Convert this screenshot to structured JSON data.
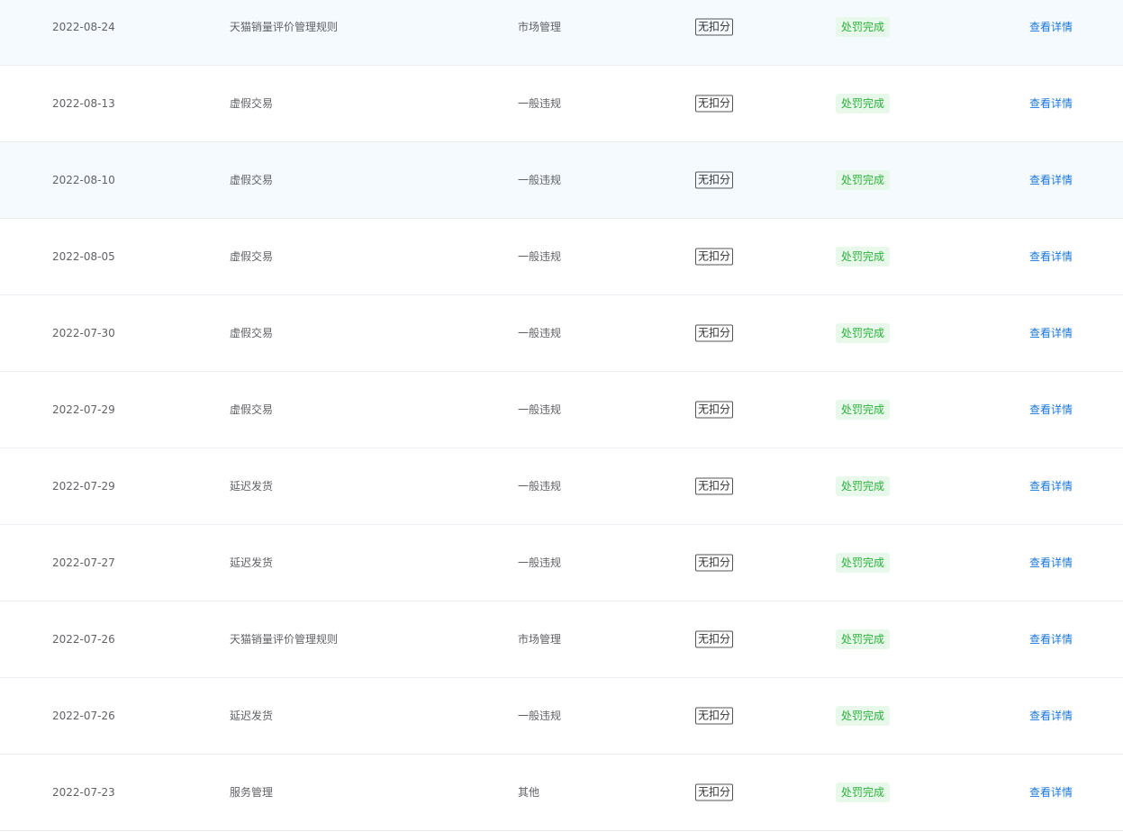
{
  "table": {
    "rows": [
      {
        "date": "2022-08-24",
        "reason": "天猫销量评价管理规则",
        "type": "市场管理",
        "points": "无扣分",
        "status": "处罚完成",
        "action": "查看详情"
      },
      {
        "date": "2022-08-13",
        "reason": "虚假交易",
        "type": "一般违规",
        "points": "无扣分",
        "status": "处罚完成",
        "action": "查看详情"
      },
      {
        "date": "2022-08-10",
        "reason": "虚假交易",
        "type": "一般违规",
        "points": "无扣分",
        "status": "处罚完成",
        "action": "查看详情"
      },
      {
        "date": "2022-08-05",
        "reason": "虚假交易",
        "type": "一般违规",
        "points": "无扣分",
        "status": "处罚完成",
        "action": "查看详情"
      },
      {
        "date": "2022-07-30",
        "reason": "虚假交易",
        "type": "一般违规",
        "points": "无扣分",
        "status": "处罚完成",
        "action": "查看详情"
      },
      {
        "date": "2022-07-29",
        "reason": "虚假交易",
        "type": "一般违规",
        "points": "无扣分",
        "status": "处罚完成",
        "action": "查看详情"
      },
      {
        "date": "2022-07-29",
        "reason": "延迟发货",
        "type": "一般违规",
        "points": "无扣分",
        "status": "处罚完成",
        "action": "查看详情"
      },
      {
        "date": "2022-07-27",
        "reason": "延迟发货",
        "type": "一般违规",
        "points": "无扣分",
        "status": "处罚完成",
        "action": "查看详情"
      },
      {
        "date": "2022-07-26",
        "reason": "天猫销量评价管理规则",
        "type": "市场管理",
        "points": "无扣分",
        "status": "处罚完成",
        "action": "查看详情"
      },
      {
        "date": "2022-07-26",
        "reason": "延迟发货",
        "type": "一般违规",
        "points": "无扣分",
        "status": "处罚完成",
        "action": "查看详情"
      },
      {
        "date": "2022-07-23",
        "reason": "服务管理",
        "type": "其他",
        "points": "无扣分",
        "status": "处罚完成",
        "action": "查看详情"
      }
    ]
  },
  "colors": {
    "row_hover_bg": "#f5faff",
    "status_bg": "#e8f8ea",
    "status_text": "#2bb23c",
    "link": "#1a76d8"
  }
}
